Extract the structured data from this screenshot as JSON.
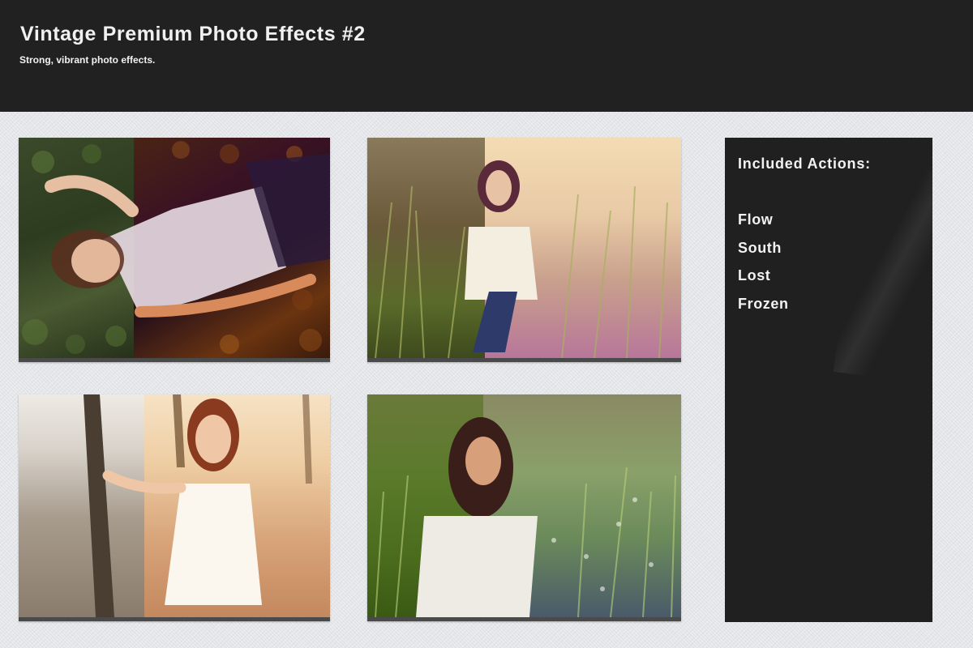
{
  "header": {
    "title": "Vintage Premium Photo Effects #2",
    "subtitle": "Strong, vibrant photo effects."
  },
  "photos": [
    {
      "scene": "woman lying on ivy leaves",
      "split": "left original, right effect"
    },
    {
      "scene": "woman sitting in tall grass",
      "split": "left original, right effect"
    },
    {
      "scene": "woman by tree on beach",
      "split": "left original, right effect"
    },
    {
      "scene": "woman in green meadow",
      "split": "left original, right effect"
    }
  ],
  "sidebar": {
    "title": "Included Actions:",
    "actions": [
      "Flow",
      "South",
      "Lost",
      "Frozen"
    ]
  },
  "colors": {
    "header_bg": "#212121",
    "page_bg": "#e4e6e9",
    "sidebar_bg": "#202020",
    "text_light": "#f2f2f2"
  }
}
